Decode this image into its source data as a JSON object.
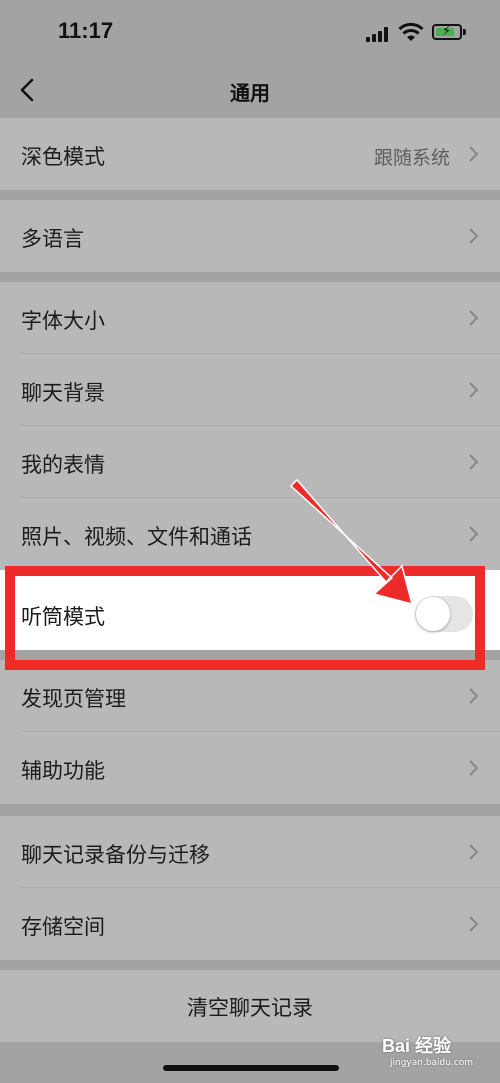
{
  "status_bar": {
    "time": "11:17"
  },
  "nav": {
    "title": "通用"
  },
  "groups": [
    {
      "items": [
        {
          "label": "深色模式",
          "value": "跟随系统"
        }
      ]
    },
    {
      "items": [
        {
          "label": "多语言"
        }
      ]
    },
    {
      "items": [
        {
          "label": "字体大小"
        },
        {
          "label": "聊天背景"
        },
        {
          "label": "我的表情"
        },
        {
          "label": "照片、视频、文件和通话"
        }
      ]
    },
    {
      "items": [
        {
          "label": "听筒模式",
          "toggle": false
        }
      ]
    },
    {
      "items": [
        {
          "label": "发现页管理"
        },
        {
          "label": "辅助功能"
        }
      ]
    },
    {
      "items": [
        {
          "label": "聊天记录备份与迁移"
        },
        {
          "label": "存储空间"
        }
      ]
    }
  ],
  "clear_chat": {
    "label": "清空聊天记录"
  },
  "watermark": {
    "text": "Bai 经验",
    "sub": "jingyan.baidu.com"
  },
  "colors": {
    "highlight": "#ee2b2b",
    "battery": "#4caf50"
  }
}
